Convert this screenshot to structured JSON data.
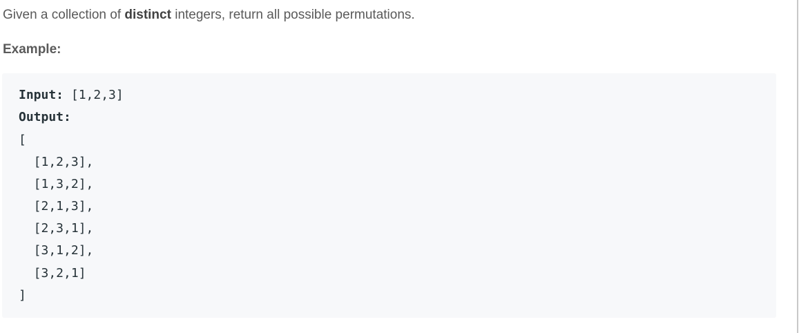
{
  "description": {
    "before": "Given a collection of ",
    "emphasis": "distinct",
    "after": " integers, return all possible permutations."
  },
  "example": {
    "heading": "Example:",
    "input_label": "Input:",
    "input_value": " [1,2,3]",
    "output_label": "Output:",
    "lines": [
      "[",
      "  [1,2,3],",
      "  [1,3,2],",
      "  [2,1,3],",
      "  [2,3,1],",
      "  [3,1,2],",
      "  [3,2,1]",
      "]"
    ]
  }
}
